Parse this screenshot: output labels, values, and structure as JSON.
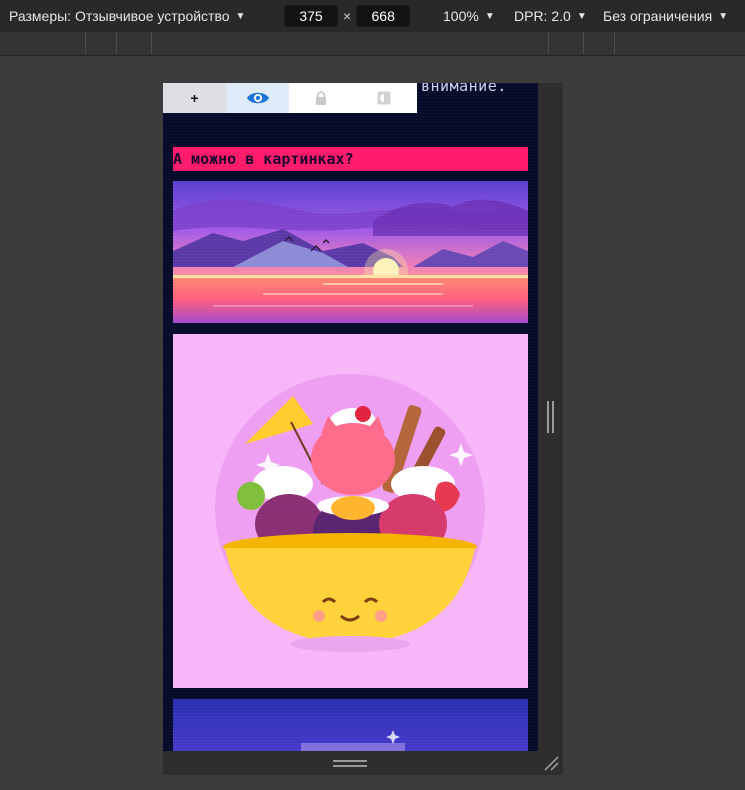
{
  "toolbar": {
    "dimensions_label": "Размеры: Отзывчивое устройство",
    "width_value": "375",
    "times": "×",
    "height_value": "668",
    "zoom_label": "100%",
    "dpr_label": "DPR: 2.0",
    "throttle_label": "Без ограничения"
  },
  "page": {
    "notice_text": "внимание.",
    "tabs": [
      {
        "icon": "plus-icon",
        "label": "+"
      },
      {
        "icon": "eye-icon"
      },
      {
        "icon": "lock-icon"
      },
      {
        "icon": "contrast-icon"
      }
    ],
    "section_title": "А можно в картинках?",
    "images": [
      {
        "name": "sunset-image",
        "description_icon": "landscape"
      },
      {
        "name": "ice-cream-sundae-image",
        "description_icon": "illustration"
      },
      {
        "name": "next-image",
        "description_icon": "illustration"
      }
    ]
  },
  "colors": {
    "toolbar_bg": "#292929",
    "page_bg": "#070b2a",
    "title_bar": "#ff1a6a",
    "eye_accent": "#1e73d8",
    "sundae_bg": "#f6b6f8"
  }
}
